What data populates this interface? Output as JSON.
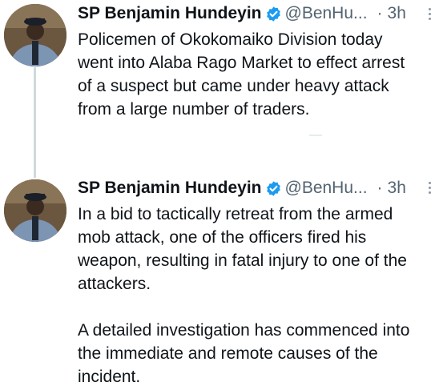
{
  "tweets": [
    {
      "author": {
        "name": "SP Benjamin Hundeyin",
        "handle": "@BenHu...",
        "verified": true
      },
      "separator": "·",
      "time": "3h",
      "text": [
        "Policemen of Okokomaiko Division today\nwent into Alaba Rago Market to effect arrest\nof a suspect but came under heavy attack\nfrom a large number of traders."
      ]
    },
    {
      "author": {
        "name": "SP Benjamin Hundeyin",
        "handle": "@BenHu...",
        "verified": true
      },
      "separator": "·",
      "time": "3h",
      "text": [
        "In a bid to tactically retreat from the armed\nmob attack, one of the officers fired his\nweapon, resulting in fatal injury to one of the\nattackers.",
        "A detailed investigation has commenced into\nthe immediate and remote causes of the\nincident."
      ]
    }
  ],
  "colors": {
    "verified": "#1d9bf0",
    "muted": "#536471",
    "thread_line": "#cfd9de"
  },
  "icons": {
    "verified": "verified-badge-icon",
    "more": "more-options-icon"
  }
}
